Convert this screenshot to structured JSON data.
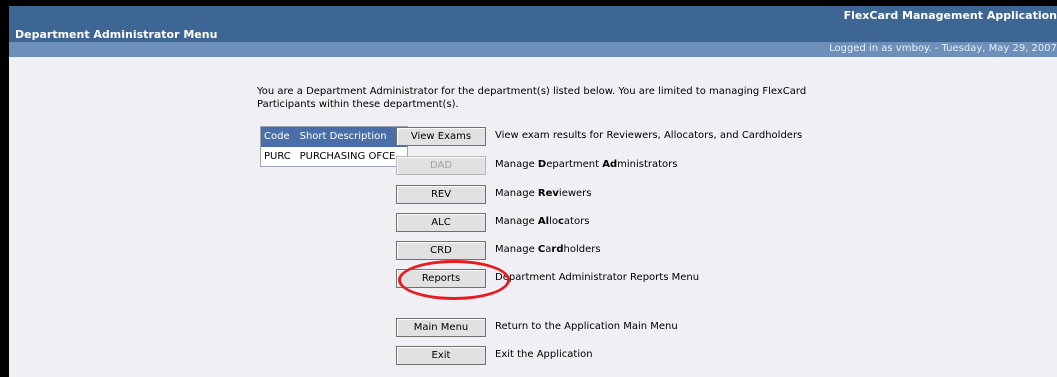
{
  "header": {
    "title": "Department Administrator Menu",
    "app_title": "FlexCard Management Application",
    "login_info": "Logged in as vmboy. - Tuesday, May 29, 2007"
  },
  "intro_text": "You are a Department Administrator for the department(s) listed below.  You are limited to managing FlexCard Participants within these department(s).",
  "dept_table": {
    "headers": [
      "Code",
      "Short Description"
    ],
    "rows": [
      [
        "PURC",
        "PURCHASING OFCE"
      ]
    ]
  },
  "menu": [
    {
      "button": "View Exams",
      "enabled": true,
      "desc_parts": [
        [
          "View exam results for Reviewers, Allocators, and Cardholders",
          false
        ]
      ]
    },
    {
      "button": "DAD",
      "enabled": false,
      "desc_parts": [
        [
          "Manage ",
          false
        ],
        [
          "D",
          true
        ],
        [
          "epartment ",
          false
        ],
        [
          "Ad",
          true
        ],
        [
          "ministrators",
          false
        ]
      ]
    },
    {
      "button": "REV",
      "enabled": true,
      "desc_parts": [
        [
          "Manage ",
          false
        ],
        [
          "Rev",
          true
        ],
        [
          "iewers",
          false
        ]
      ]
    },
    {
      "button": "ALC",
      "enabled": true,
      "desc_parts": [
        [
          "Manage ",
          false
        ],
        [
          "Al",
          true
        ],
        [
          "lo",
          false
        ],
        [
          "c",
          true
        ],
        [
          "ators",
          false
        ]
      ]
    },
    {
      "button": "CRD",
      "enabled": true,
      "desc_parts": [
        [
          "Manage ",
          false
        ],
        [
          "C",
          true
        ],
        [
          "a",
          false
        ],
        [
          "rd",
          true
        ],
        [
          "holders",
          false
        ]
      ]
    },
    {
      "button": "Reports",
      "enabled": true,
      "desc_parts": [
        [
          "Department Administrator Reports Menu",
          false
        ]
      ]
    },
    {
      "button": "Main Menu",
      "enabled": true,
      "desc_parts": [
        [
          "Return to the Application Main Menu",
          false
        ]
      ]
    },
    {
      "button": "Exit",
      "enabled": true,
      "desc_parts": [
        [
          "Exit the Application",
          false
        ]
      ]
    }
  ],
  "annotation_color": "#e51d23"
}
